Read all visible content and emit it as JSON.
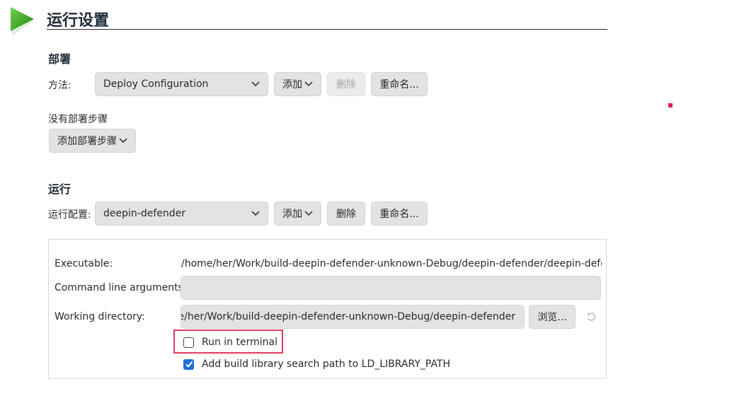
{
  "header": {
    "title": "运行设置"
  },
  "deploy": {
    "heading": "部署",
    "method_label": "方法:",
    "method_value": "Deploy Configuration",
    "add_label": "添加",
    "remove_label": "删除",
    "rename_label": "重命名...",
    "no_steps_text": "没有部署步骤",
    "add_step_label": "添加部署步骤"
  },
  "run": {
    "heading": "运行",
    "config_label": "运行配置:",
    "config_value": "deepin-defender",
    "add_label": "添加",
    "remove_label": "删除",
    "rename_label": "重命名..."
  },
  "run_panel": {
    "executable_label": "Executable:",
    "executable_value": "/home/her/Work/build-deepin-defender-unknown-Debug/deepin-defender/deepin-defende",
    "cmd_args_label": "Command line arguments:",
    "cmd_args_value": "",
    "working_dir_label": "Working directory:",
    "working_dir_value": "ne/her/Work/build-deepin-defender-unknown-Debug/deepin-defender",
    "browse_label": "浏览...",
    "run_in_terminal_label": "Run in terminal",
    "run_in_terminal_checked": false,
    "ld_path_label": "Add build library search path to LD_LIBRARY_PATH",
    "ld_path_checked": true
  },
  "colors": {
    "accent": "#1d6fd6",
    "highlight": "#e33a5f",
    "play_icon": "#3fae2a"
  }
}
